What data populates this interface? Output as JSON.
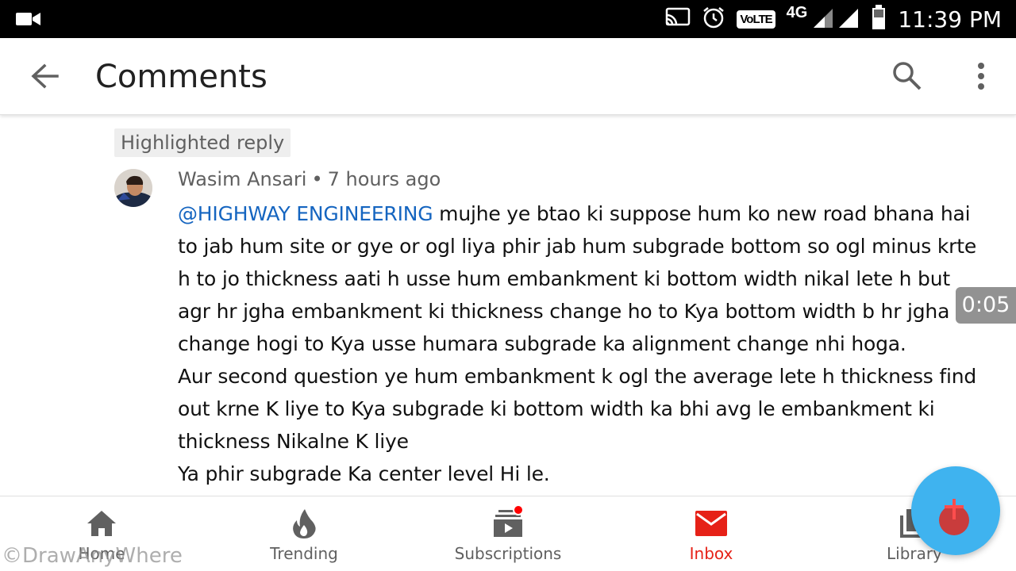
{
  "status_bar": {
    "time": "11:39 PM",
    "network": "4G",
    "volte": "VoLTE",
    "icons": [
      "video-camera-icon",
      "cast-icon",
      "alarm-icon",
      "volte-icon",
      "signal-icon",
      "battery-icon"
    ]
  },
  "app_bar": {
    "title": "Comments",
    "icons": [
      "back-arrow-icon",
      "search-icon",
      "more-vert-icon"
    ]
  },
  "comment": {
    "chip": "Highlighted reply",
    "author": "Wasim Ansari",
    "separator": "•",
    "time": "7 hours ago",
    "mention": "@HIGHWAY ENGINEERING",
    "text": " mujhe ye btao ki suppose hum ko new road bhana hai to jab hum site or gye or ogl liya phir jab hum subgrade bottom so ogl minus krte h to jo thickness aati h usse hum embankment ki bottom width nikal lete h but agr hr jgha embankment ki thickness change ho to Kya bottom width b hr jgha change hogi to Kya usse humara  subgrade ka alignment change nhi hoga.\nAur second question ye hum embankment k  ogl the average lete h thickness find out krne K liye to Kya subgrade ki bottom width ka bhi avg le embankment ki thickness Nikalne K liye\nYa phir  subgrade Ka center level Hi le."
  },
  "timer": "0:05",
  "bottom_nav": {
    "items": [
      {
        "label": "Home",
        "icon": "home-icon"
      },
      {
        "label": "Trending",
        "icon": "flame-icon"
      },
      {
        "label": "Subscriptions",
        "icon": "subscriptions-icon"
      },
      {
        "label": "Inbox",
        "icon": "mail-icon"
      },
      {
        "label": "Library",
        "icon": "library-icon"
      }
    ],
    "active": "Inbox"
  },
  "watermark": "©DrawAnyWhere",
  "colors": {
    "accent_red": "#e62117",
    "mention_blue": "#1565c0",
    "fab_blue": "#3fb3ef"
  }
}
